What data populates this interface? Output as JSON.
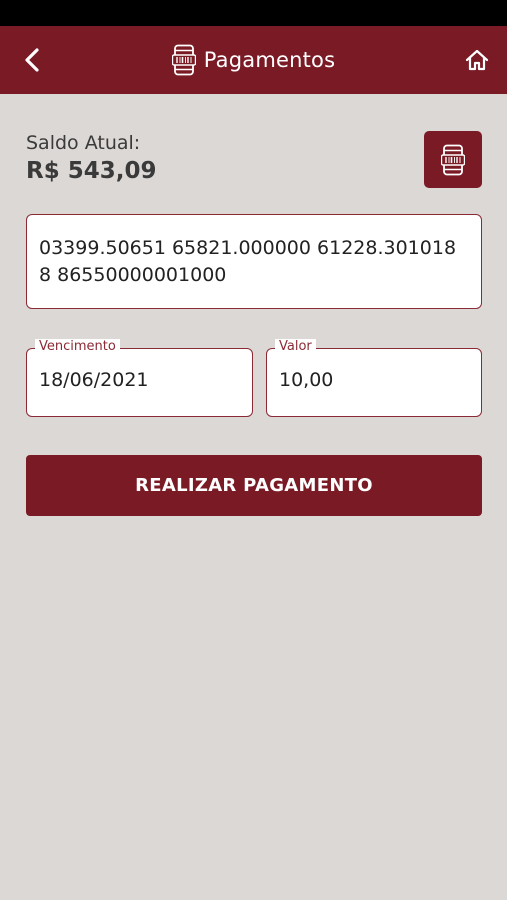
{
  "header": {
    "title": "Pagamentos",
    "back_icon": "chevron-left-icon",
    "title_icon": "barcode-phone-icon",
    "home_icon": "home-icon"
  },
  "balance": {
    "label": "Saldo Atual:",
    "value": "R$ 543,09"
  },
  "scan_button": {
    "icon": "barcode-phone-icon"
  },
  "barcode": {
    "value": "03399.50651 65821.000000 61228.301018 8 86550000001000"
  },
  "due_date": {
    "label": "Vencimento",
    "value": "18/06/2021"
  },
  "amount": {
    "label": "Valor",
    "value": "10,00"
  },
  "pay_button": {
    "label": "REALIZAR PAGAMENTO"
  },
  "colors": {
    "brand": "#7a1a25",
    "background": "#dcd8d5",
    "field_border": "#8a2a35"
  }
}
